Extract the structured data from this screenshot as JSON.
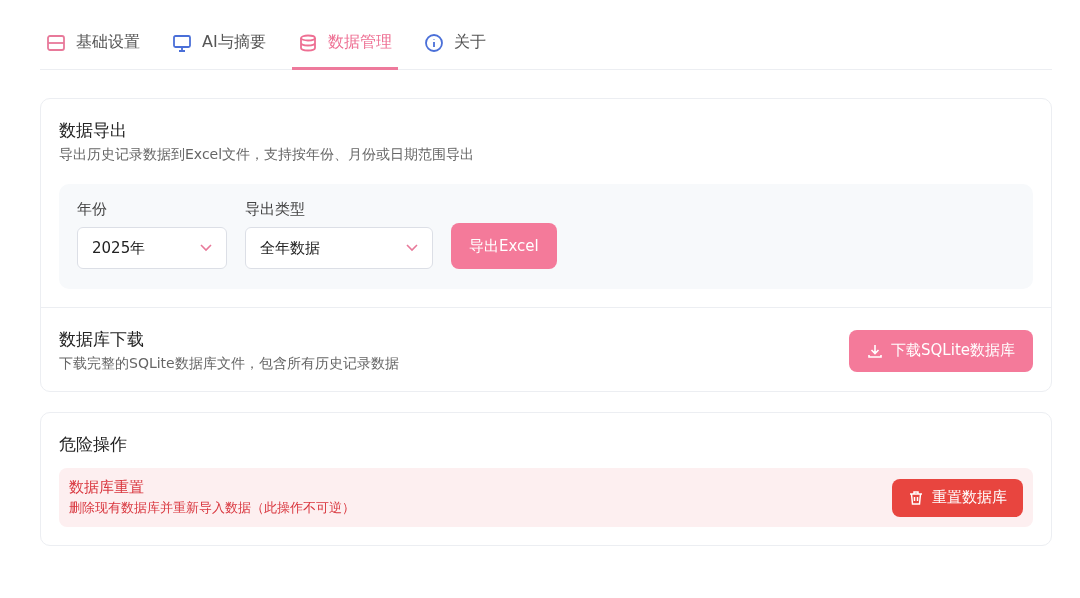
{
  "tabs": [
    {
      "label": "基础设置",
      "kind": "settings",
      "color": "#e8799a",
      "selected": false
    },
    {
      "label": "AI与摘要",
      "kind": "monitor",
      "color": "#4a6fd8",
      "selected": false
    },
    {
      "label": "数据管理",
      "kind": "database",
      "color": "#ee6f93",
      "selected": true
    },
    {
      "label": "关于",
      "kind": "info",
      "color": "#4a6fd8",
      "selected": false
    }
  ],
  "export": {
    "title": "数据导出",
    "description": "导出历史记录数据到Excel文件，支持按年份、月份或日期范围导出",
    "year": {
      "label": "年份",
      "value": "2025年"
    },
    "type": {
      "label": "导出类型",
      "value": "全年数据"
    },
    "button": "导出Excel"
  },
  "download": {
    "title": "数据库下载",
    "description": "下载完整的SQLite数据库文件，包含所有历史记录数据",
    "button": "下载SQLite数据库"
  },
  "danger": {
    "title": "危险操作",
    "item_title": "数据库重置",
    "item_description": "删除现有数据库并重新导入数据（此操作不可逆）",
    "button": "重置数据库"
  }
}
